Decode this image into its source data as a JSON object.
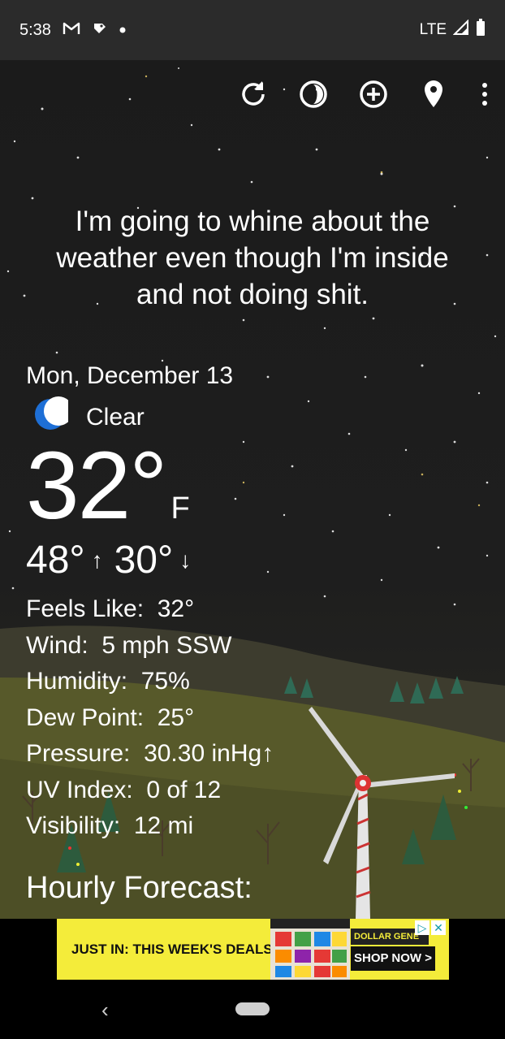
{
  "status_bar": {
    "time": "5:38",
    "network": "LTE",
    "icons": [
      "gmail-icon",
      "notification-icon",
      "dot-icon",
      "signal-icon",
      "battery-icon"
    ]
  },
  "toolbar": {
    "icons": [
      "refresh-icon",
      "theme-icon",
      "add-location-icon",
      "location-pin-icon",
      "more-icon"
    ]
  },
  "quote": {
    "line1": "I'm going to whine about the",
    "line2": "weather even though I'm inside",
    "line3": "and not doing shit."
  },
  "current": {
    "date": "Mon, December 13",
    "condition": "Clear",
    "condition_icon": "moon-icon",
    "temperature": "32°",
    "unit": "F",
    "high": "48°",
    "low": "30°",
    "high_arrow": "↑",
    "low_arrow": "↓"
  },
  "details": [
    {
      "label": "Feels Like:",
      "value": "32°"
    },
    {
      "label": "Wind:",
      "value": "5 mph SSW"
    },
    {
      "label": "Humidity:",
      "value": "75%"
    },
    {
      "label": "Dew Point:",
      "value": "25°"
    },
    {
      "label": "Pressure:",
      "value": "30.30 inHg↑"
    },
    {
      "label": "UV Index:",
      "value": "0 of 12"
    },
    {
      "label": "Visibility:",
      "value": "12 mi"
    }
  ],
  "hourly": {
    "title": "Hourly Forecast:"
  },
  "ad": {
    "headline": "JUST IN: THIS WEEK'S DEALS.",
    "brand": "DOLLAR GENE",
    "cta": "SHOP NOW >"
  },
  "colors": {
    "sky": "#1b1b1b",
    "moon": "#1e6fd6",
    "ad_background": "#f4ec3a",
    "hill": "#57592a"
  }
}
